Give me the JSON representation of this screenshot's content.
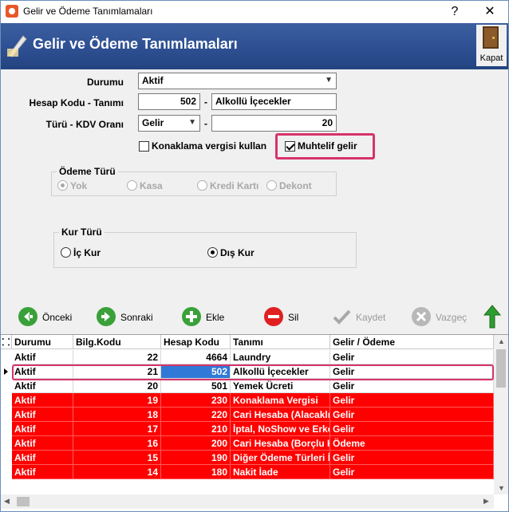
{
  "window": {
    "title": "Gelir ve Ödeme Tanımlamaları",
    "help_glyph": "?",
    "close_glyph": "✕"
  },
  "banner": {
    "title": "Gelir ve Ödeme Tanımlamaları",
    "close_label": "Kapat"
  },
  "form": {
    "status_label": "Durumu",
    "status_value": "Aktif",
    "account_label": "Hesap Kodu - Tanımı",
    "account_code": "502",
    "account_name": "Alkollü İçecekler",
    "type_label": "Türü - KDV Oranı",
    "type_value": "Gelir",
    "vat_rate": "20",
    "dash": "-",
    "accommodation_tax_label": "Konaklama vergisi kullan",
    "accommodation_tax_checked": false,
    "misc_income_label": "Muhtelif gelir",
    "misc_income_checked": true
  },
  "payment_type": {
    "title": "Ödeme Türü",
    "options": [
      {
        "label": "Yok",
        "selected": true
      },
      {
        "label": "Kasa",
        "selected": false
      },
      {
        "label": "Kredi Kartı",
        "selected": false
      },
      {
        "label": "Dekont",
        "selected": false
      }
    ]
  },
  "rate_type": {
    "title": "Kur Türü",
    "options": [
      {
        "label": "İç Kur",
        "selected": false
      },
      {
        "label": "Dış Kur",
        "selected": true
      }
    ]
  },
  "toolbar": {
    "prev": "Önceki",
    "next": "Sonraki",
    "add": "Ekle",
    "delete": "Sil",
    "save": "Kaydet",
    "cancel": "Vazgeç"
  },
  "grid": {
    "headers": [
      "Durumu",
      "Bilg.Kodu",
      "Hesap Kodu",
      "Tanımı",
      "Gelir / Ödeme"
    ],
    "rows": [
      {
        "status": "Aktif",
        "info_code": "22",
        "account_code": "4664",
        "name": "Laundry",
        "kind": "Gelir",
        "red": false
      },
      {
        "status": "Aktif",
        "info_code": "21",
        "account_code": "502",
        "name": "Alkollü İçecekler",
        "kind": "Gelir",
        "red": false
      },
      {
        "status": "Aktif",
        "info_code": "20",
        "account_code": "501",
        "name": "Yemek Ücreti",
        "kind": "Gelir",
        "red": false
      },
      {
        "status": "Aktif",
        "info_code": "19",
        "account_code": "230",
        "name": "Konaklama Vergisi",
        "kind": "Gelir",
        "red": true
      },
      {
        "status": "Aktif",
        "info_code": "18",
        "account_code": "220",
        "name": "Cari Hesaba (Alacaklı",
        "kind": "Gelir",
        "red": true
      },
      {
        "status": "Aktif",
        "info_code": "17",
        "account_code": "210",
        "name": "İptal, NoShow ve Erke",
        "kind": "Gelir",
        "red": true
      },
      {
        "status": "Aktif",
        "info_code": "16",
        "account_code": "200",
        "name": "Cari Hesaba (Borçlu K",
        "kind": "Ödeme",
        "red": true
      },
      {
        "status": "Aktif",
        "info_code": "15",
        "account_code": "190",
        "name": "Diğer Ödeme Türleri İ",
        "kind": "Gelir",
        "red": true
      },
      {
        "status": "Aktif",
        "info_code": "14",
        "account_code": "180",
        "name": "Nakit İade",
        "kind": "Gelir",
        "red": true
      }
    ],
    "selected_row": 1
  },
  "colors": {
    "banner": "#2f5194",
    "highlight": "#d6336c",
    "row_red": "#ff0000",
    "selection": "#3079d6"
  }
}
